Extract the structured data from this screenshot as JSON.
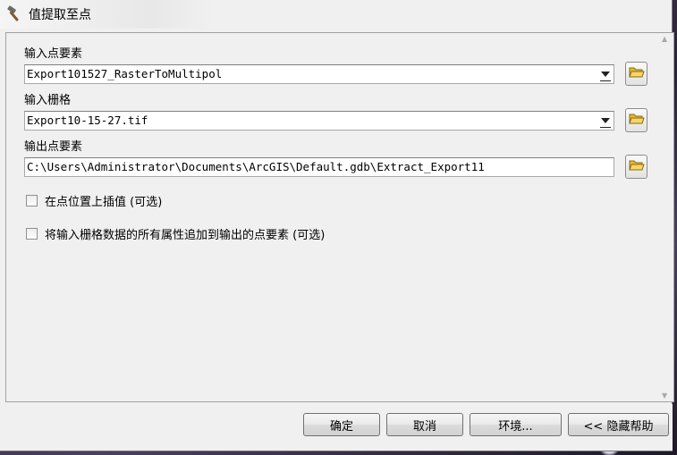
{
  "window": {
    "title": "值提取至点",
    "icon": "hammer-icon"
  },
  "params": {
    "input_points_label": "输入点要素",
    "input_points_value": "Export101527_RasterToMultipol",
    "input_raster_label": "输入栅格",
    "input_raster_value": "Export10-15-27.tif",
    "output_points_label": "输出点要素",
    "output_points_value": "C:\\Users\\Administrator\\Documents\\ArcGIS\\Default.gdb\\Extract_Export11",
    "interpolate_label": "在点位置上插值 (可选)",
    "interpolate_checked": false,
    "append_attrs_label": "将输入栅格数据的所有属性追加到输出的点要素 (可选)",
    "append_attrs_checked": false,
    "browse_icon": "open-folder-icon",
    "dropdown_icon": "chevron-down-icon"
  },
  "footer": {
    "ok_label": "确定",
    "cancel_label": "取消",
    "env_label": "环境...",
    "help_label": "<< 隐藏帮助"
  },
  "colors": {
    "dialog_bg": "#f0f0f0",
    "field_border": "#a8a8a8",
    "folder_yellow": "#e8b830"
  }
}
